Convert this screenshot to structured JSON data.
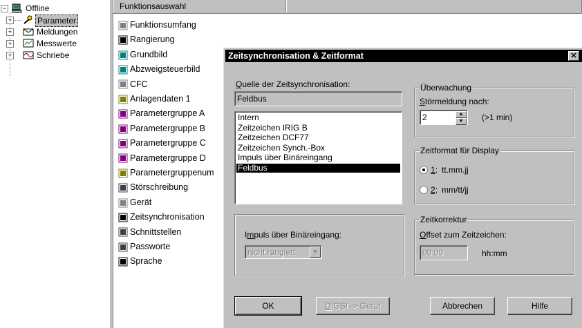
{
  "tree": {
    "root": {
      "label": "Offline",
      "expander": "−"
    },
    "items": [
      {
        "label": "Parameter",
        "expander": "+"
      },
      {
        "label": "Meldungen",
        "expander": "+"
      },
      {
        "label": "Messwerte",
        "expander": "+"
      },
      {
        "label": "Schriebe",
        "expander": "+"
      }
    ]
  },
  "function_panel": {
    "header": "Funktionsauswahl",
    "items": [
      {
        "label": "Funktionsumfang",
        "icon": "book-icon"
      },
      {
        "label": "Rangierung",
        "icon": "matrix-icon"
      },
      {
        "label": "Grundbild",
        "icon": "display-icon"
      },
      {
        "label": "Abzweigsteuerbild",
        "icon": "control-display-icon"
      },
      {
        "label": "CFC",
        "icon": "cfc-icon"
      },
      {
        "label": "Anlagendaten 1",
        "icon": "plant-data-icon"
      },
      {
        "label": "Parametergruppe A",
        "icon": "param-group-icon"
      },
      {
        "label": "Parametergruppe B",
        "icon": "param-group-icon"
      },
      {
        "label": "Parametergruppe C",
        "icon": "param-group-icon"
      },
      {
        "label": "Parametergruppe D",
        "icon": "param-group-icon"
      },
      {
        "label": "Parametergruppenum",
        "icon": "param-switch-icon"
      },
      {
        "label": "Störschreibung",
        "icon": "fault-record-icon"
      },
      {
        "label": "Gerät",
        "icon": "device-icon"
      },
      {
        "label": "Zeitsynchronisation",
        "icon": "clock-icon"
      },
      {
        "label": "Schnittstellen",
        "icon": "interface-icon"
      },
      {
        "label": "Passworte",
        "icon": "key-icon"
      },
      {
        "label": "Sprache",
        "icon": "language-icon"
      }
    ]
  },
  "dialog": {
    "title": "Zeitsynchronisation & Zeitformat",
    "close_glyph": "✕",
    "source": {
      "label_prefix": "Q",
      "label_rest": "uelle der Zeitsynchronisation:",
      "current": "Feldbus",
      "options": [
        "Intern",
        "Zeitzeichen IRIG B",
        "Zeitzeichen DCF77",
        "Zeitzeichen Synch.-Box",
        "Impuls über Binäreingang",
        "Feldbus"
      ],
      "selected_index": 5
    },
    "impulse": {
      "label_pre": "I",
      "label_u": "m",
      "label_rest": "puls über Binäreingang:",
      "value": "nicht rangiert"
    },
    "monitoring": {
      "title": "Überwachung",
      "label_u": "S",
      "label_rest": "törmeldung nach:",
      "value": "2",
      "unit": "(>1 min)"
    },
    "display_format": {
      "title": "Zeitformat für Display",
      "options": [
        {
          "key": "1",
          "suffix": ":",
          "text": "tt.mm.jj",
          "checked": true
        },
        {
          "key": "2",
          "suffix": ":",
          "text": "mm/tt/jj",
          "checked": false
        }
      ]
    },
    "correction": {
      "title": "Zeitkorrektur",
      "label_u": "O",
      "label_rest": "ffset zum Zeitzeichen:",
      "value": "00:00",
      "unit": "hh:mm"
    },
    "buttons": {
      "ok": "OK",
      "digsi_u": "D",
      "digsi_rest": "IGSI -> Gerät",
      "cancel": "Abbrechen",
      "help": "Hilfe"
    }
  }
}
